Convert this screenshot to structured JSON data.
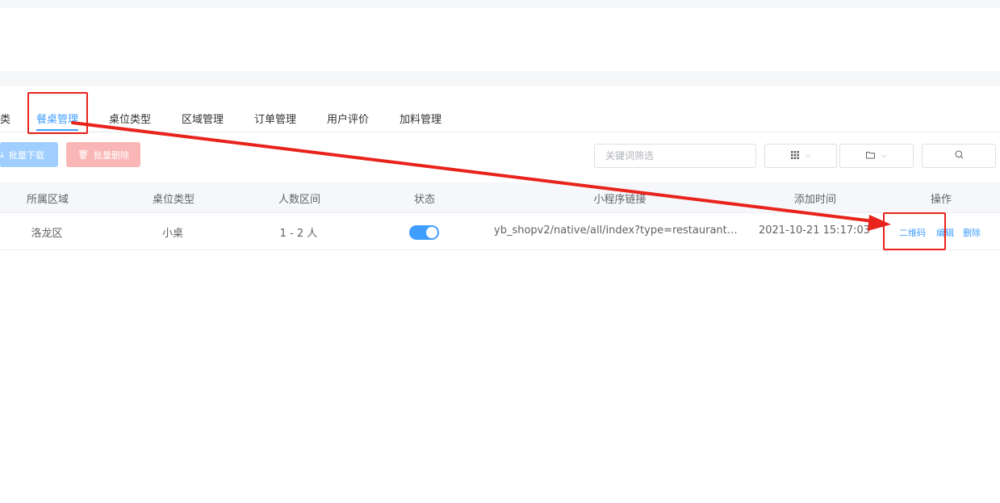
{
  "tabs": [
    {
      "label": "类"
    },
    {
      "label": "餐桌管理",
      "active": true
    },
    {
      "label": "桌位类型"
    },
    {
      "label": "区域管理"
    },
    {
      "label": "订单管理"
    },
    {
      "label": "用户评价"
    },
    {
      "label": "加料管理"
    }
  ],
  "toolbar": {
    "batch_download": {
      "icon": "download-icon",
      "label": "批量下载"
    },
    "batch_delete": {
      "icon": "trash-icon",
      "label": "批量删除"
    },
    "search_placeholder": "关键词筛选",
    "view_toggle_icon": "grid-icon",
    "folder_toggle_icon": "folder-icon",
    "search_icon": "search-icon"
  },
  "table": {
    "columns": [
      "所属区域",
      "桌位类型",
      "人数区间",
      "状态",
      "小程序链接",
      "添加时间",
      "操作"
    ],
    "rows": [
      {
        "area": "洛龙区",
        "type": "小桌",
        "people": "1 - 2 人",
        "status_on": true,
        "link": "yb_shopv2/native/all/index?type=restaurant&table...",
        "added": "2021-10-21 15:17:03",
        "actions": [
          "二维码",
          "编辑",
          "删除"
        ]
      }
    ]
  },
  "colors": {
    "accent": "#409eff",
    "annotation": "#e8231c",
    "danger_light": "#fab6b6",
    "primary_light": "#a0cfff"
  }
}
